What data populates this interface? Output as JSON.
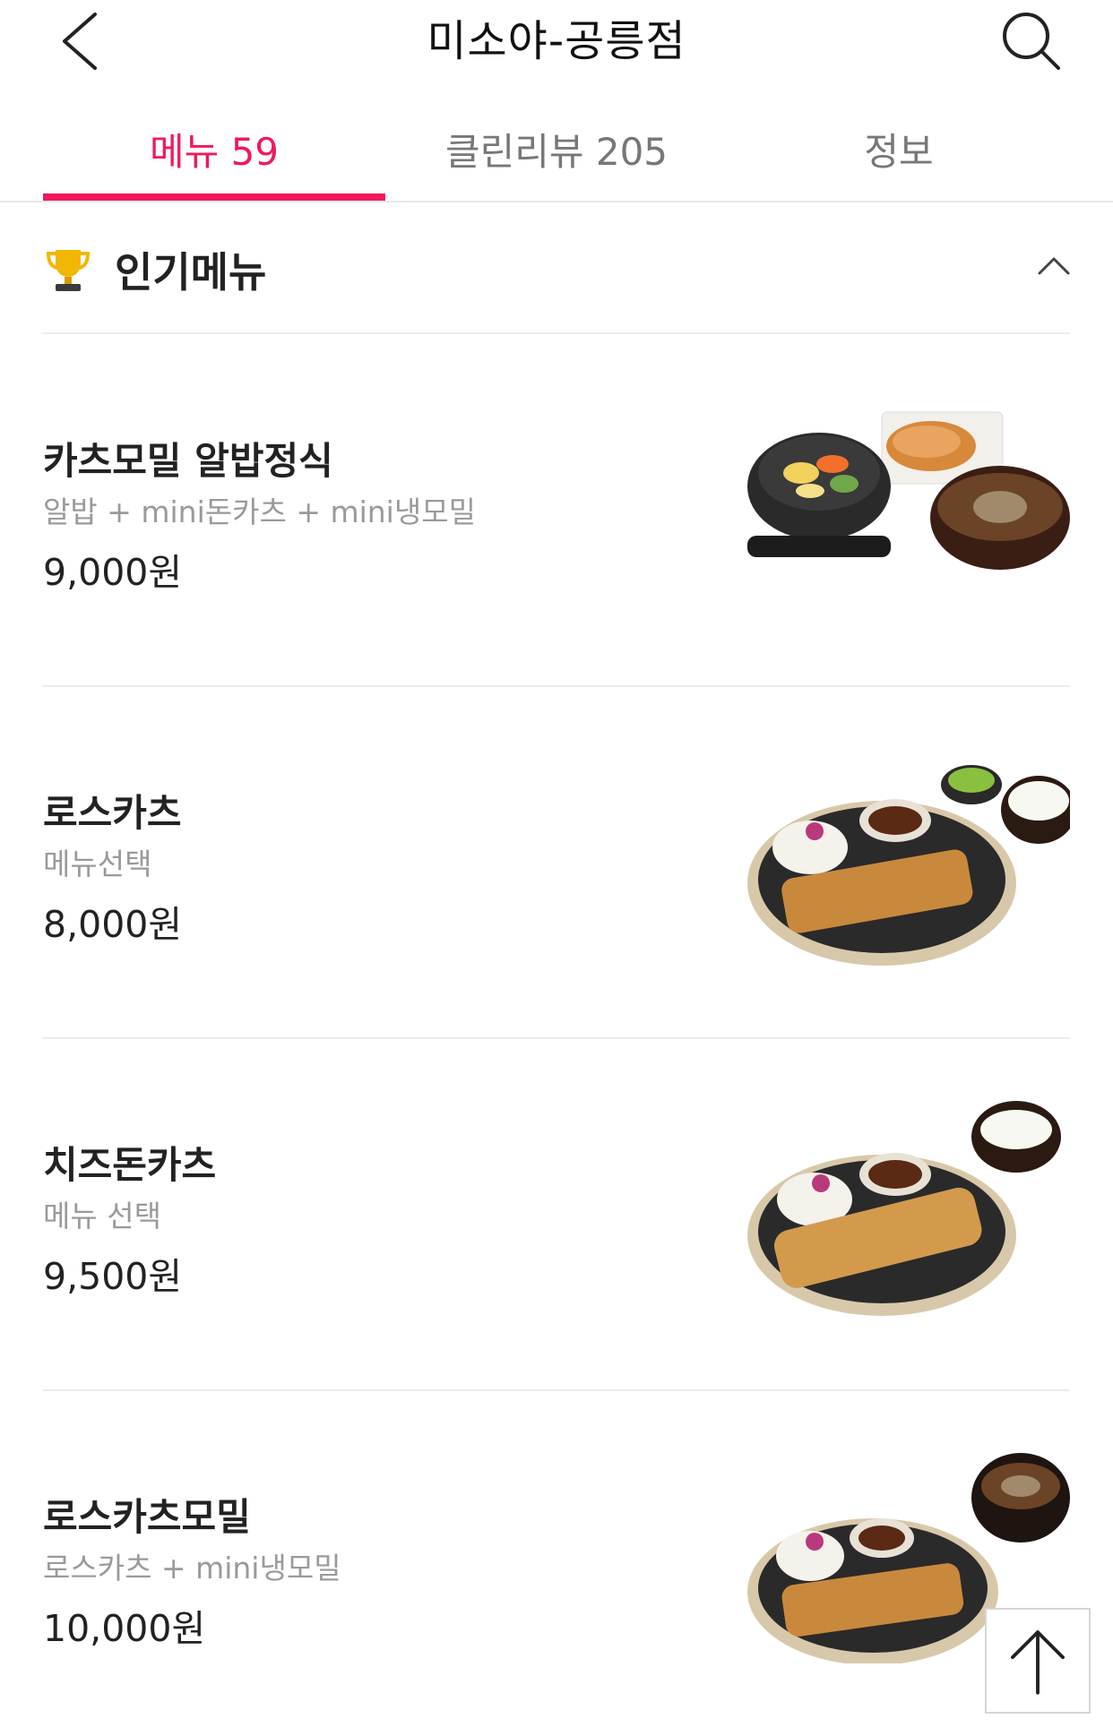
{
  "header": {
    "title": "미소야-공릉점",
    "back_icon": "chevron-left-icon",
    "search_icon": "search-icon"
  },
  "tabs": [
    {
      "label": "메뉴 59",
      "active": true
    },
    {
      "label": "클린리뷰 205",
      "active": false
    },
    {
      "label": "정보",
      "active": false
    }
  ],
  "section": {
    "title": "인기메뉴",
    "icon": "trophy-icon",
    "toggle_icon": "chevron-up-icon"
  },
  "items": [
    {
      "name": "카츠모밀 알밥정식",
      "desc": "알밥 + mini돈카츠 + mini냉모밀",
      "price": "9,000원"
    },
    {
      "name": "로스카츠",
      "desc": "메뉴선택",
      "price": "8,000원"
    },
    {
      "name": "치즈돈카츠",
      "desc": "메뉴 선택",
      "price": "9,500원"
    },
    {
      "name": "로스카츠모밀",
      "desc": "로스카츠 + mini냉모밀",
      "price": "10,000원"
    }
  ],
  "scroll_top_icon": "arrow-up-icon",
  "colors": {
    "accent": "#f0195c",
    "divider": "#ececec",
    "muted": "#9a9a9a"
  }
}
